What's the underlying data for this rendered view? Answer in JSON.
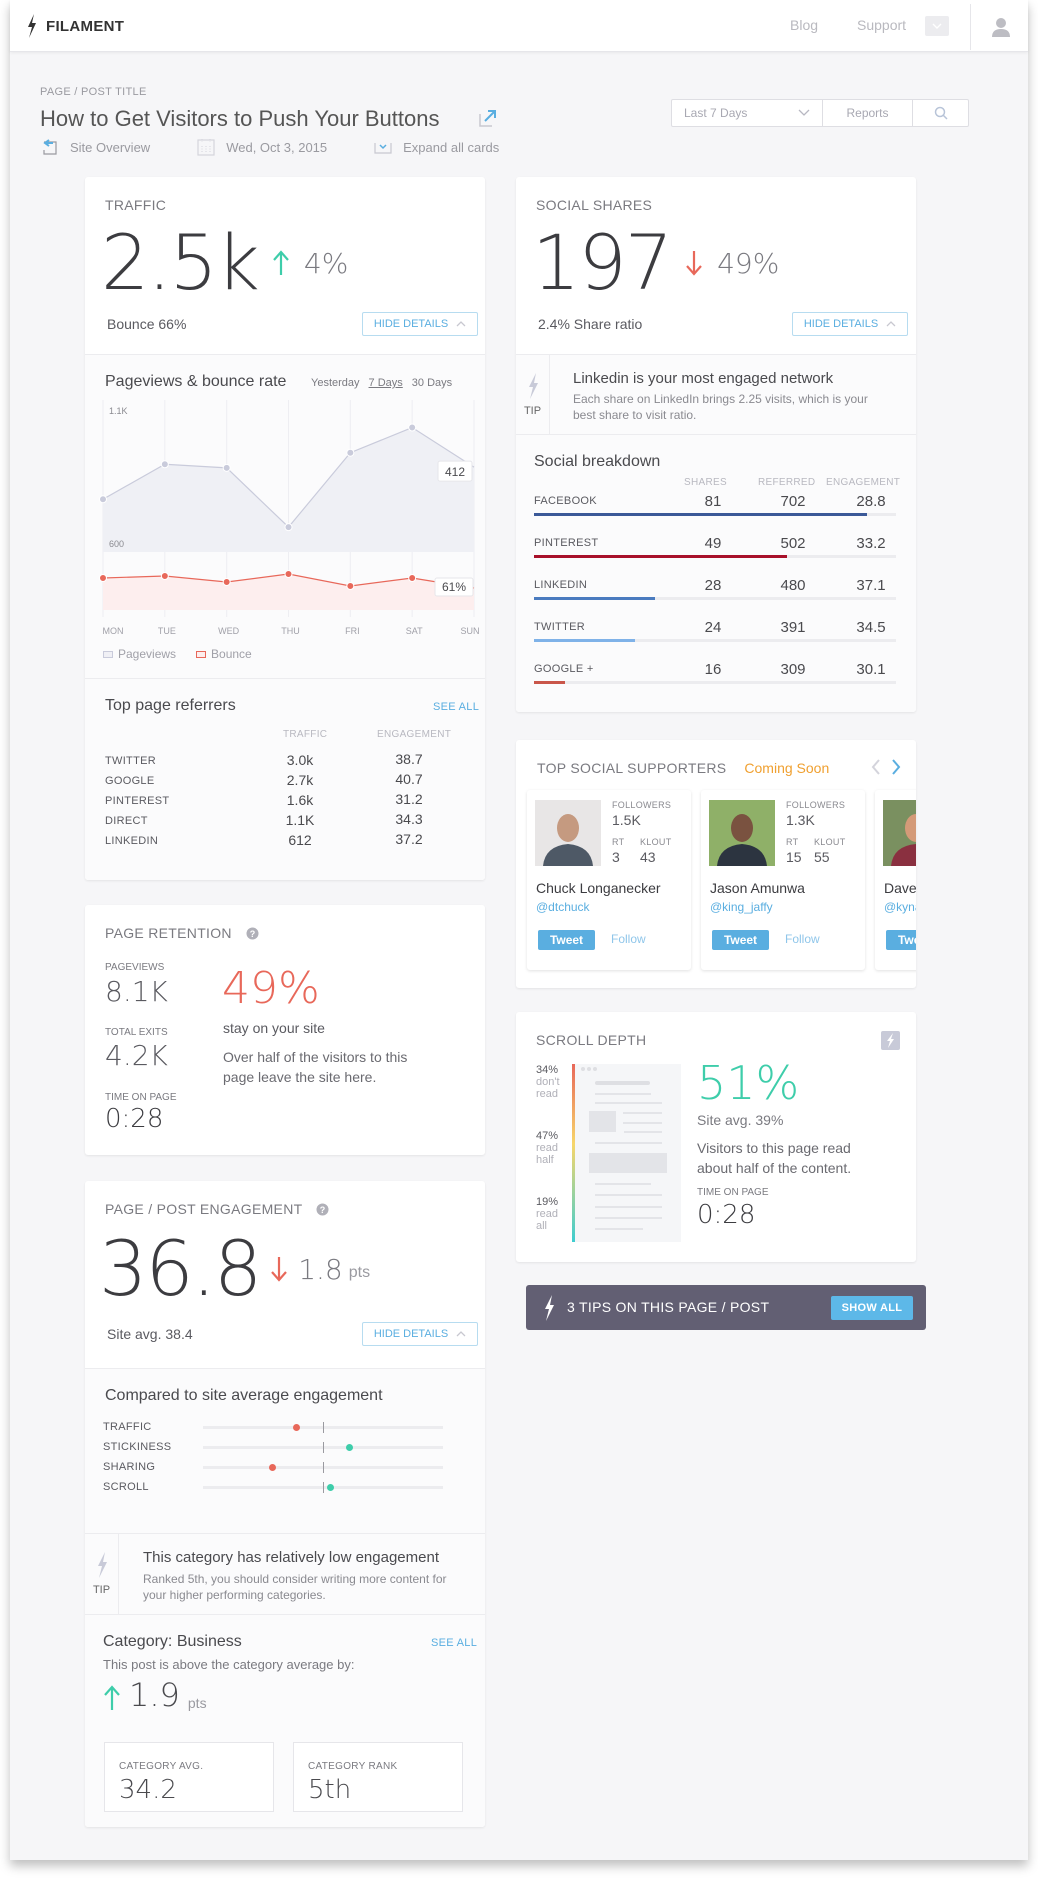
{
  "app": {
    "brand": "FILAMENT",
    "nav": {
      "blog": "Blog",
      "support": "Support"
    }
  },
  "header": {
    "breadcrumb": "PAGE / POST TITLE",
    "title": "How to Get Visitors to Push Your Buttons",
    "subnav": {
      "site_overview": "Site Overview",
      "date": "Wed, Oct 3, 2015",
      "expand": "Expand all cards"
    },
    "controls": {
      "range": "Last 7 Days",
      "reports": "Reports"
    }
  },
  "traffic": {
    "label": "TRAFFIC",
    "value": "2.5k",
    "delta": "4%",
    "delta_direction": "up",
    "bounce": "Bounce 66%",
    "hide_details": "HIDE DETAILS",
    "chart_title": "Pageviews & bounce rate",
    "ranges": [
      "Yesterday",
      "7 Days",
      "30 Days"
    ],
    "active_range": "7 Days",
    "legend": {
      "pageviews": "Pageviews",
      "bounce": "Bounce"
    }
  },
  "chart_data": {
    "type": "line",
    "title": "Pageviews & bounce rate",
    "categories": [
      "MON",
      "TUE",
      "WED",
      "THU",
      "FRI",
      "SAT",
      "SUN"
    ],
    "y_tick_labels": [
      "1.1K",
      "600"
    ],
    "ylim": [
      600,
      1100
    ],
    "series": [
      {
        "name": "Pageviews",
        "values": [
          753,
          899,
          884,
          637,
          947,
          1052,
          887
        ],
        "end_label": "412",
        "color": "#c9cbdb"
      },
      {
        "name": "Bounce",
        "values": [
          66,
          67,
          64,
          68,
          62,
          66,
          61
        ],
        "end_label": "61%",
        "color": "#e8685a"
      }
    ],
    "legend": "bottom-left",
    "grid": true
  },
  "referrers": {
    "title": "Top page referrers",
    "see_all": "SEE ALL",
    "columns": [
      "TRAFFIC",
      "ENGAGEMENT"
    ],
    "rows": [
      {
        "name": "TWITTER",
        "traffic": "3.0k",
        "engagement": "38.7"
      },
      {
        "name": "GOOGLE",
        "traffic": "2.7k",
        "engagement": "40.7"
      },
      {
        "name": "PINTEREST",
        "traffic": "1.6k",
        "engagement": "31.2"
      },
      {
        "name": "DIRECT",
        "traffic": "1.1K",
        "engagement": "34.3"
      },
      {
        "name": "LINKEDIN",
        "traffic": "612",
        "engagement": "37.2"
      }
    ]
  },
  "retention": {
    "label": "PAGE RETENTION",
    "pageviews_label": "PAGEVIEWS",
    "pageviews": "8.1K",
    "exits_label": "TOTAL EXITS",
    "exits": "4.2K",
    "time_label": "TIME ON PAGE",
    "time": "0:28",
    "percent": "49%",
    "stay": "stay on your site",
    "desc": "Over half of the visitors to this page leave the site here."
  },
  "engagement": {
    "label": "PAGE / POST ENGAGEMENT",
    "value": "36.8",
    "delta": "1.8",
    "delta_unit": "pts",
    "delta_direction": "down",
    "site_avg": "Site avg. 38.4",
    "hide_details": "HIDE DETAILS",
    "compare_title": "Compared to site average engagement",
    "compare": [
      {
        "name": "TRAFFIC",
        "position": 0.39,
        "status": "below"
      },
      {
        "name": "STICKINESS",
        "position": 0.61,
        "status": "above"
      },
      {
        "name": "SHARING",
        "position": 0.29,
        "status": "below"
      },
      {
        "name": "SCROLL",
        "position": 0.53,
        "status": "above"
      }
    ],
    "tip_label": "TIP",
    "tip_title": "This category has relatively low engagement",
    "tip_text": "Ranked 5th, you should consider writing more content for your higher performing categories.",
    "category_title": "Category: Business",
    "category_see_all": "SEE ALL",
    "category_desc": "This post is above the category average by:",
    "category_delta": "1.9",
    "category_delta_unit": "pts",
    "category_avg_label": "CATEGORY AVG.",
    "category_avg": "34.2",
    "category_rank_label": "CATEGORY RANK",
    "category_rank": "5th"
  },
  "social": {
    "label": "SOCIAL SHARES",
    "value": "197",
    "delta": "49%",
    "delta_direction": "down",
    "share_ratio": "2.4% Share ratio",
    "hide_details": "HIDE DETAILS",
    "tip_label": "TIP",
    "tip_title": "Linkedin is your most engaged network",
    "tip_text": "Each share on LinkedIn brings 2.25 visits, which is your best share to visit ratio.",
    "breakdown_title": "Social breakdown",
    "columns": [
      "SHARES",
      "REFERRED",
      "ENGAGEMENT"
    ],
    "rows": [
      {
        "name": "FACEBOOK",
        "shares": "81",
        "referred": "702",
        "engagement": "28.8",
        "fill": 0.92,
        "color": "#3b5998"
      },
      {
        "name": "PINTEREST",
        "shares": "49",
        "referred": "502",
        "engagement": "33.2",
        "fill": 0.7,
        "color": "#a8102a"
      },
      {
        "name": "LINKEDIN",
        "shares": "28",
        "referred": "480",
        "engagement": "37.1",
        "fill": 0.335,
        "color": "#4a7bbf"
      },
      {
        "name": "TWITTER",
        "shares": "24",
        "referred": "391",
        "engagement": "34.5",
        "fill": 0.28,
        "color": "#7fb2e8"
      },
      {
        "name": "GOOGLE +",
        "shares": "16",
        "referred": "309",
        "engagement": "30.1",
        "fill": 0.085,
        "color": "#c9564a"
      }
    ]
  },
  "supporters": {
    "label": "TOP SOCIAL SUPPORTERS",
    "coming_soon": "Coming Soon",
    "followers_label": "FOLLOWERS",
    "rt_label": "RT",
    "klout_label": "KLOUT",
    "tweet": "Tweet",
    "follow": "Follow",
    "people": [
      {
        "name": "Chuck Longanecker",
        "handle": "@dtchuck",
        "followers": "1.5K",
        "rt": "3",
        "klout": "43"
      },
      {
        "name": "Jason Amunwa",
        "handle": "@king_jaffy",
        "followers": "1.3K",
        "rt": "15",
        "klout": "55"
      },
      {
        "name": "Dave",
        "handle": "@kyna",
        "followers": "",
        "rt": "",
        "klout": ""
      }
    ]
  },
  "scroll": {
    "label": "SCROLL DEPTH",
    "segments": [
      {
        "pct": "34%",
        "text": "don't read"
      },
      {
        "pct": "47%",
        "text": "read half"
      },
      {
        "pct": "19%",
        "text": "read all"
      }
    ],
    "value": "51%",
    "site_avg": "Site avg. 39%",
    "desc": "Visitors to this page read about half of the content.",
    "time_label": "TIME ON PAGE",
    "time": "0:28"
  },
  "tips_bar": {
    "text": "3 TIPS ON THIS PAGE / POST",
    "button": "SHOW ALL"
  },
  "colors": {
    "accent": "#5aaee0",
    "up": "#3ecdaa",
    "down": "#e8685a",
    "coming_soon": "#f0a030",
    "tips_bar": "#625f73"
  }
}
